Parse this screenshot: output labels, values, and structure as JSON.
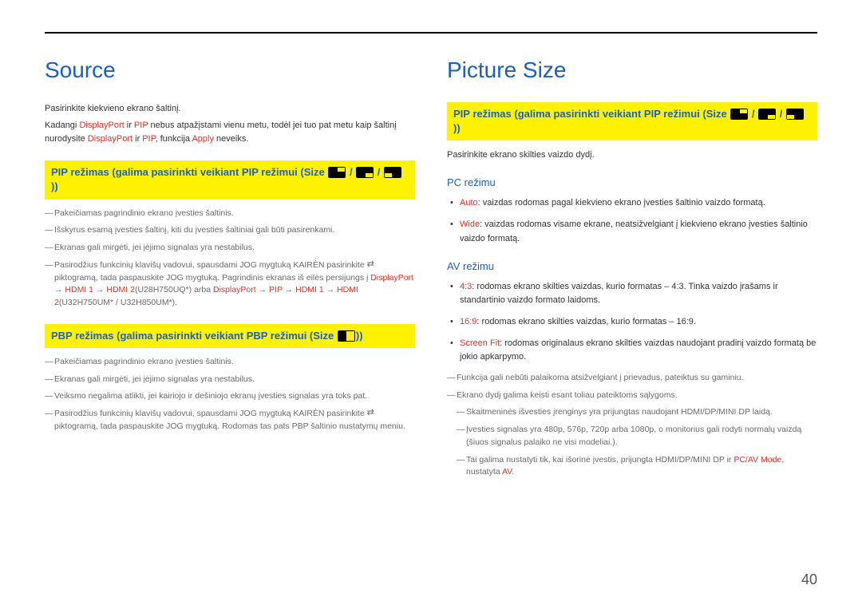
{
  "pageNumber": "40",
  "left": {
    "title": "Source",
    "p1": "Pasirinkite kiekvieno ekrano šaltinį.",
    "p2_a": "Kadangi ",
    "p2_b": "DisplayPort",
    "p2_c": " ir ",
    "p2_d": "PIP",
    "p2_e": " nebus atpažįstami vienu metu, todėl jei tuo pat metu kaip šaltinį nurodysite ",
    "p2_f": "DisplayPort",
    "p2_g": " ir ",
    "p2_h": "PIP",
    "p2_i": ", funkcija ",
    "p2_j": "Apply",
    "p2_k": " neveiks.",
    "hl1": "PIP režimas (galima pasirinkti veikiant PIP režimui (Size",
    "hl1_end": "))",
    "n1": "Pakeičiamas pagrindinio ekrano įvesties šaltinis.",
    "n2": "Išskyrus esamą įvesties šaltinį, kiti du įvesties šaltiniai gali būti pasirenkami.",
    "n3": "Ekranas gali mirgėti, jei įėjimo signalas yra nestabilus.",
    "n4_a": "Pasirodžius funkcinių klavišų vadovui, spausdami JOG mygtuką KAIRĖN pasirinkite ",
    "n4_b": " piktogramą, tada paspauskite JOG mygtuką. Pagrindinis ekranas iš eilės persijungs į ",
    "n4_c": "DisplayPort",
    "n4_d": " → ",
    "n4_e": "HDMI 1",
    "n4_f": " → ",
    "n4_g": "HDMI 2",
    "n4_h": "(U28H750UQ*) arba ",
    "n4_i": "DisplayPort",
    "n4_j": " → ",
    "n4_k": "PIP",
    "n4_l": " → ",
    "n4_m": "HDMI 1",
    "n4_n": " → ",
    "n4_o": "HDMI 2",
    "n4_p": "(U32H750UM* / U32H850UM*).",
    "hl2": "PBP režimas (galima pasirinkti veikiant PBP režimui (Size",
    "hl2_end": "))",
    "n5": "Pakeičiamas pagrindinio ekrano įvesties šaltinis.",
    "n6": "Ekranas gali mirgėti, jei įėjimo signalas yra nestabilus.",
    "n7": "Veiksmo negalima atlikti, jei kairiojo ir dešiniojo ekranų įvesties signalas yra toks pat.",
    "n8_a": "Pasirodžius funkcinių klavišų vadovui, spausdami JOG mygtuką KAIRĖN pasirinkite ",
    "n8_b": " piktogramą, tada paspauskite JOG mygtuką. Rodomas tas pats PBP šaltinio nustatymų meniu."
  },
  "right": {
    "title": "Picture Size",
    "hl1": "PIP režimas (galima pasirinkti veikiant PIP režimui (Size",
    "hl1_end": "))",
    "p1": "Pasirinkite ekrano skilties vaizdo dydį.",
    "sub_pc": "PC režimu",
    "pc_b1_a": "Auto",
    "pc_b1_b": ": vaizdas rodomas pagal kiekvieno ekrano įvesties šaltinio vaizdo formatą.",
    "pc_b2_a": "Wide",
    "pc_b2_b": ": vaizdas rodomas visame ekrane, neatsižvelgiant į kiekvieno ekrano įvesties šaltinio vaizdo formatą.",
    "sub_av": "AV režimu",
    "av_b1_a": "4:3",
    "av_b1_b": ": rodomas ekrano skilties vaizdas, kurio formatas – 4:3. Tinka vaizdo įrašams ir standartinio vaizdo formato laidoms.",
    "av_b2_a": "16:9",
    "av_b2_b": ": rodomas ekrano skilties vaizdas, kurio formatas – 16:9.",
    "av_b3_a": "Screen Fit",
    "av_b3_b": ": rodomas originalaus ekrano skilties vaizdas naudojant pradinį vaizdo formatą be jokio apkarpymo.",
    "n1": "Funkcija gali nebūti palaikoma atsižvelgiant į prievadus, pateiktus su gaminiu.",
    "n2": "Ekrano dydį galima keisti esant toliau pateiktoms sąlygoms.",
    "n2a": "Skaitmeninės išvesties įrenginys yra prijungtas naudojant HDMI/DP/MINI DP laidą.",
    "n2b": "Įvesties signalas yra 480p, 576p, 720p arba 1080p, o monitorius gali rodyti normalų vaizdą (šiuos signalus palaiko ne visi modeliai.).",
    "n2c_a": "Tai galima nustatyti tik, kai išorinė įvestis, prijungta HDMI/DP/MINI DP ir ",
    "n2c_b": "PC/AV Mode",
    "n2c_c": ", nustatyta ",
    "n2c_d": "AV",
    "n2c_e": "."
  }
}
